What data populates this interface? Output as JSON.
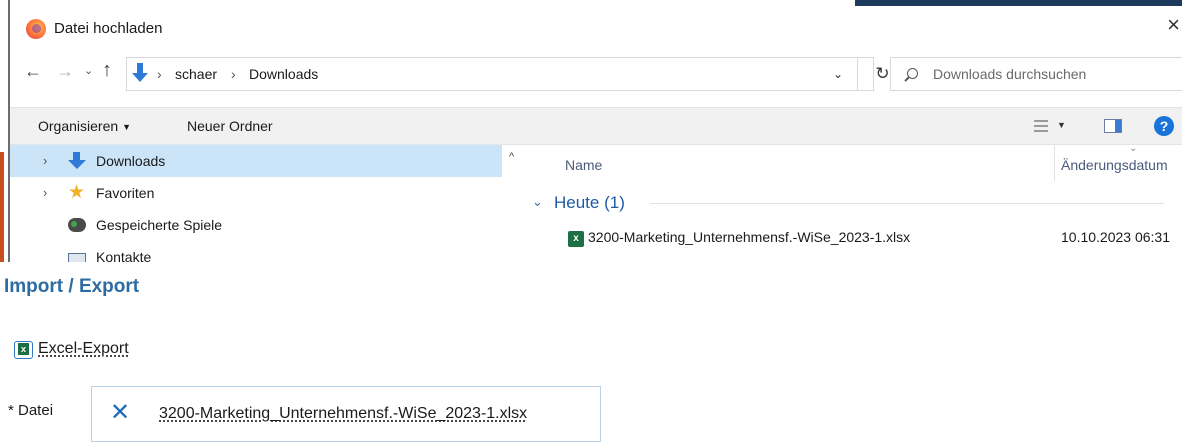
{
  "dialog": {
    "title": "Datei hochladen",
    "close_glyph": "×",
    "nav": {
      "back_glyph": "←",
      "forward_glyph": "→",
      "recent_glyph": "⌄",
      "up_glyph": "↑"
    },
    "breadcrumb": [
      "schaer",
      "Downloads"
    ],
    "breadcrumb_separator": "›",
    "address_dropdown_glyph": "⌄",
    "refresh_glyph": "↻",
    "search_placeholder": "Downloads durchsuchen",
    "toolbar": {
      "organize_label": "Organisieren",
      "organize_caret": "▼",
      "new_folder_label": "Neuer Ordner",
      "view_caret": "▼",
      "help_glyph": "?"
    },
    "navigation_pane": {
      "items": [
        {
          "label": "Downloads",
          "icon": "download-folder-icon",
          "expander": "›",
          "selected": true
        },
        {
          "label": "Favoriten",
          "icon": "star-icon",
          "expander": "›",
          "selected": false
        },
        {
          "label": "Gespeicherte Spiele",
          "icon": "game-controller-icon",
          "expander": "",
          "selected": false
        },
        {
          "label": "Kontakte",
          "icon": "contacts-icon",
          "expander": "",
          "selected": false
        }
      ],
      "scroll_up_glyph": "^"
    },
    "file_list": {
      "columns": {
        "name": "Name",
        "date": "Änderungsdatum"
      },
      "sort_glyph": "⌄",
      "group": {
        "label": "Heute (1)",
        "chevron": "⌄"
      },
      "files": [
        {
          "name": "3200-Marketing_Unternehmensf.-WiSe_2023-1.xlsx",
          "date": "10.10.2023 06:31",
          "icon": "excel-file-icon"
        }
      ]
    }
  },
  "import_export": {
    "title": "Import / Export",
    "excel_export_label": "Excel-Export",
    "file_field_label": "* Datei",
    "remove_glyph": "✕",
    "selected_file": "3200-Marketing_Unternehmensf.-WiSe_2023-1.xlsx"
  },
  "colors": {
    "selection": "#cce4f7",
    "accent_blue": "#2d6ca3",
    "excel_green": "#1d7044",
    "link_blue": "#1e6bb8"
  }
}
